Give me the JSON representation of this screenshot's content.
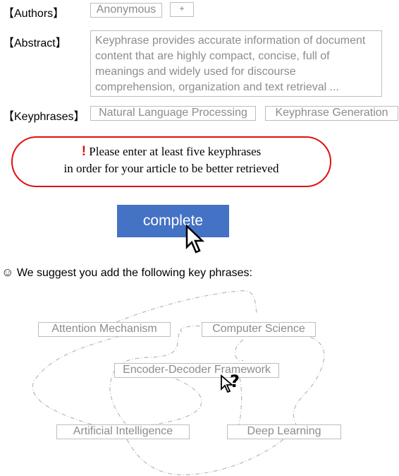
{
  "form": {
    "authors": {
      "label": "【Authors】",
      "value": "Anonymous",
      "add_label": "+"
    },
    "abstract": {
      "label": "【Abstract】",
      "text": "Keyphrase provides accurate information of document content that are highly compact, concise, full of meanings and widely used for discourse comprehension, organization and text retrieval ..."
    },
    "keyphrases": {
      "label": "【Keyphrases】",
      "items": [
        "Natural Language Processing",
        "Keyphrase Generation"
      ]
    }
  },
  "alert": {
    "icon": "!",
    "line1": "Please enter at least five keyphrases",
    "line2": "in order for your article to be better retrieved",
    "color": "#e01010"
  },
  "complete_button": {
    "label": "complete",
    "color": "#4472c4"
  },
  "suggestions": {
    "icon": "☺",
    "heading": "We suggest you add the following key phrases:",
    "items": [
      "Attention Mechanism",
      "Computer Science",
      "Encoder-Decoder Framework",
      "Artificial Intelligence",
      "Deep Learning"
    ],
    "question_mark": "?"
  }
}
